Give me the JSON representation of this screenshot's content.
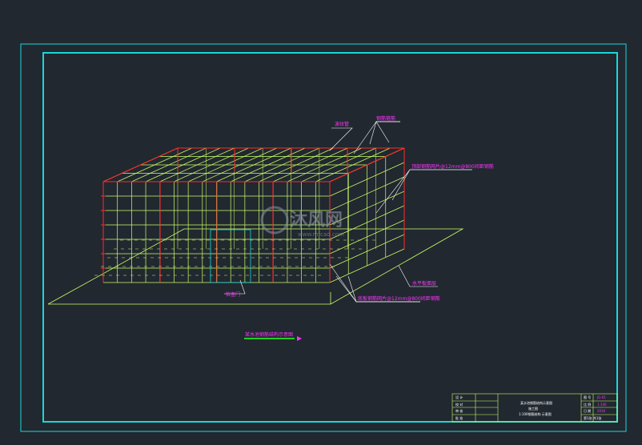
{
  "colors": {
    "background": "#212830",
    "border": "#19d7d7",
    "frame": "#ccff66",
    "column": "#ff2a2a",
    "annotation": "#ff33ff",
    "leader": "#ffffff",
    "title_underline": "#22cc22",
    "door": "#19d7d7"
  },
  "labels": {
    "top_plate": "波纹管",
    "stirrup": "钢筋箍筋",
    "upper_rebar": "顶部钢筋网片@12mm@800间距钢筋",
    "slab": "水平板面层",
    "bottom_rebar": "底板钢筋网片@12mm@800间距钢筋",
    "door": "检查门",
    "figure_title": "某水池钢筋结构示意图"
  },
  "title_block": {
    "left_rows": [
      "设 计",
      "校 对",
      "审 核",
      "批 准"
    ],
    "center_lines": [
      "某水池钢筋结构示意图",
      "施工图",
      "1:100钢筋结构 示意图"
    ],
    "right_rows": [
      "图 号",
      "比 例",
      "日 期",
      "第1张 共1张"
    ],
    "right_values": [
      "JG-01",
      "1:100",
      "2016"
    ]
  },
  "watermark": {
    "brand": "沐风网",
    "url": "www.mfcad.com"
  }
}
